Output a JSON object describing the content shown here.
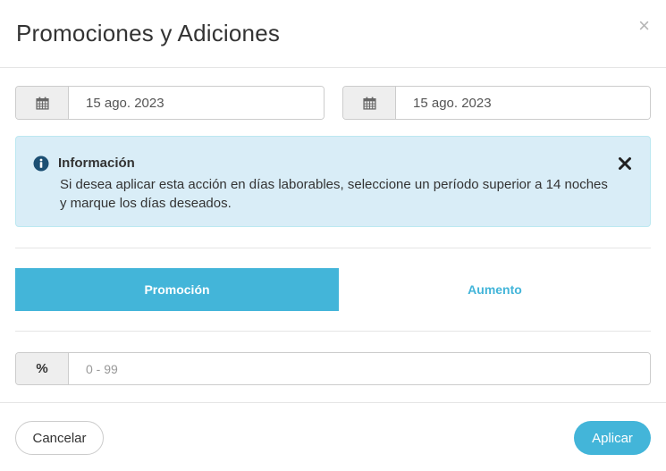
{
  "modal": {
    "title": "Promociones y Adiciones",
    "close_glyph": "×"
  },
  "dates": {
    "start": {
      "icon": "calendar-icon",
      "value": "15 ago. 2023"
    },
    "end": {
      "icon": "calendar-icon",
      "value": "15 ago. 2023"
    }
  },
  "alert": {
    "icon": "info-circle-icon",
    "title": "Información",
    "text": "Si desea aplicar esta acción en días laborables, seleccione un período superior a 14 noches y marque los días deseados.",
    "close_icon": "close-bold-icon"
  },
  "tabs": [
    {
      "label": "Promoción",
      "active": true
    },
    {
      "label": "Aumento",
      "active": false
    }
  ],
  "percent": {
    "addon": "%",
    "value": "",
    "placeholder": "0 - 99"
  },
  "footer": {
    "cancel_label": "Cancelar",
    "apply_label": "Aplicar"
  },
  "colors": {
    "accent": "#43b5d9",
    "alert_bg": "#d9edf7",
    "alert_border": "#bce8f1",
    "addon_bg": "#eeeeee"
  }
}
